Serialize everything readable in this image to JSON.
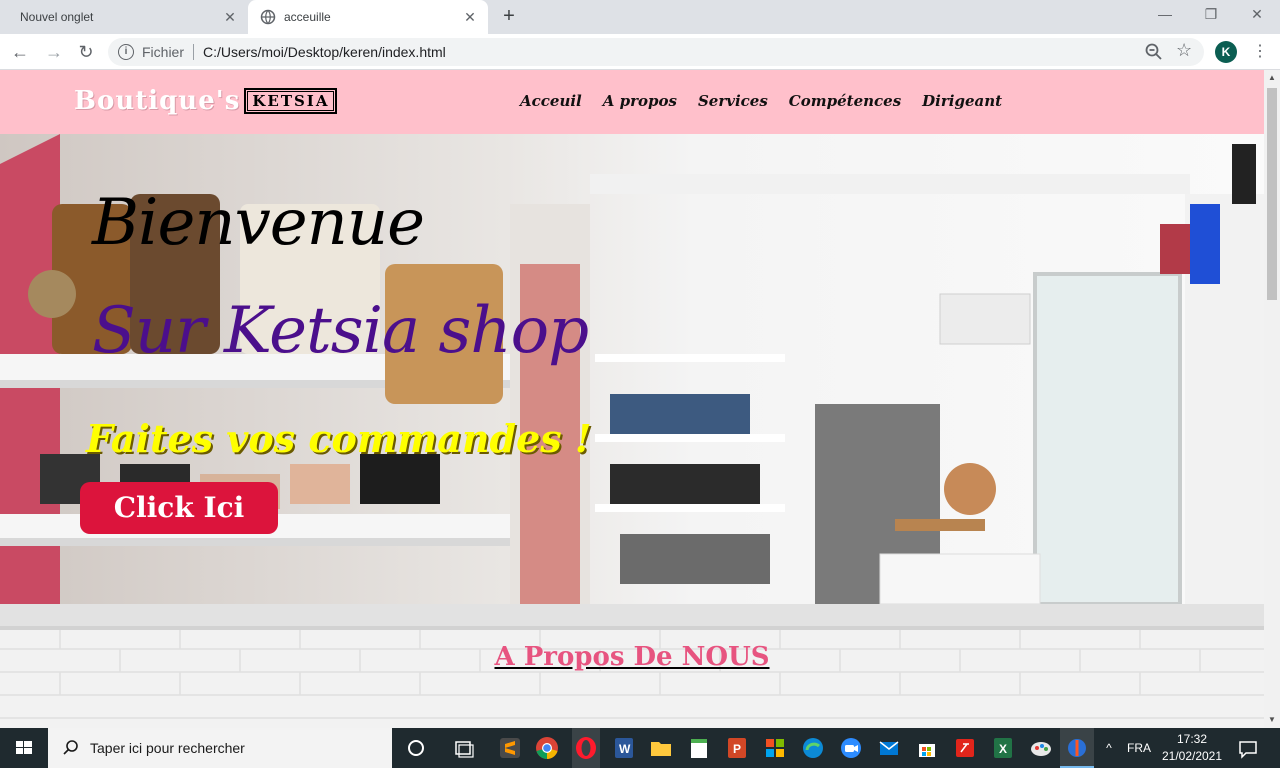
{
  "browser": {
    "tabs": [
      {
        "label": "Nouvel onglet"
      },
      {
        "label": "acceuille"
      }
    ],
    "address": {
      "scheme_label": "Fichier",
      "url": "C:/Users/moi/Desktop/keren/index.html"
    },
    "profile_initial": "K"
  },
  "site": {
    "logo": {
      "text": "Boutique's",
      "boxed": "KETSIA"
    },
    "nav": [
      "Acceuil",
      "A propos",
      "Services",
      "Compétences",
      "Dirigeant"
    ],
    "hero": {
      "title": "Bienvenue",
      "subtitle": "Sur Ketsia shop",
      "tagline": "Faites vos commandes !",
      "button": "Click Ici"
    },
    "about": {
      "title": "A Propos De NOUS"
    }
  },
  "taskbar": {
    "search_placeholder": "Taper ici pour rechercher",
    "language": "FRA",
    "time": "17:32",
    "date": "21/02/2021"
  },
  "colors": {
    "header_bg": "#ffc0cb",
    "subtitle": "#4b0f8c",
    "tagline": "#ffff00",
    "button_bg": "#dc143c",
    "about_title": "#e75480"
  }
}
